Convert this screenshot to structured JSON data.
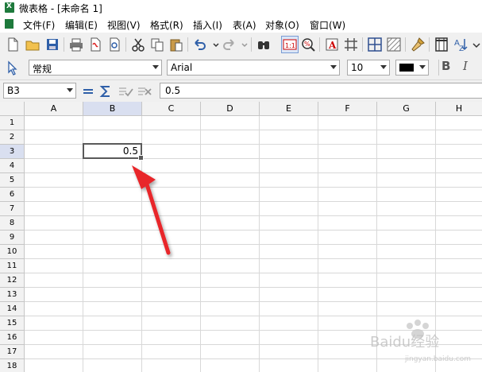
{
  "window": {
    "title": "微表格 - [未命名 1]"
  },
  "menu": [
    "文件(F)",
    "编辑(E)",
    "视图(V)",
    "格式(R)",
    "插入(I)",
    "表(A)",
    "对象(O)",
    "窗口(W)"
  ],
  "format_bar": {
    "style": "常规",
    "font": "Arial",
    "size": "10",
    "bold_label": "B",
    "italic_label": "I"
  },
  "formula_bar": {
    "cell_ref": "B3",
    "content": "0.5"
  },
  "sheet": {
    "columns": [
      "A",
      "B",
      "C",
      "D",
      "E",
      "F",
      "G",
      "H"
    ],
    "rows": [
      "1",
      "2",
      "3",
      "4",
      "5",
      "6",
      "7",
      "8",
      "9",
      "10",
      "11",
      "12",
      "13",
      "14",
      "15",
      "16",
      "17",
      "18"
    ],
    "selected_cell": {
      "col": "B",
      "row": "3",
      "value": "0.5"
    }
  },
  "watermark": {
    "text": "Baidu经验",
    "sub": "jingyan.baidu.com"
  },
  "colors": {
    "selected_header": "#d9dff0",
    "arrow": "#e8262a",
    "toolbar_bg": "#f0f0f0"
  }
}
